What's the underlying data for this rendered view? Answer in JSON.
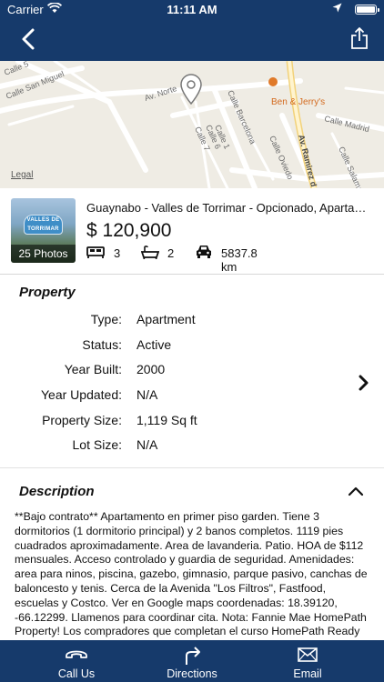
{
  "status_bar": {
    "carrier": "Carrier",
    "time": "11:11 AM"
  },
  "nav": {
    "back_icon": "chevron-left-icon",
    "share_icon": "share-icon"
  },
  "map": {
    "legal": "Legal",
    "street_labels": [
      "Calle 5",
      "Calle San Miguel",
      "Av. Norte",
      "Calle Barcelona",
      "Calle 6",
      "Calle 7",
      "Calle 1",
      "Calle Madrid",
      "Calle Oviedo",
      "Av. Ramirez d",
      "Calle Salaman"
    ],
    "poi": "Ben & Jerry's",
    "pin_icon": "map-pin-icon"
  },
  "listing": {
    "photo_count": "25 Photos",
    "photo_sign": "VALLES DE TORRIMAR",
    "title": "Guaynabo - Valles de Torrimar - Opcionado, Apartamento",
    "price": "$ 120,900",
    "beds": "3",
    "baths": "2",
    "distance": "5837.8 km"
  },
  "property": {
    "title": "Property",
    "rows": [
      {
        "label": "Type:",
        "value": "Apartment"
      },
      {
        "label": "Status:",
        "value": "Active"
      },
      {
        "label": "Year Built:",
        "value": "2000"
      },
      {
        "label": "Year Updated:",
        "value": "N/A"
      },
      {
        "label": "Property Size:",
        "value": "1,119 Sq ft"
      },
      {
        "label": "Lot Size:",
        "value": "N/A"
      }
    ]
  },
  "description": {
    "title": "Description",
    "text": "**Bajo contrato** Apartamento en primer piso garden. Tiene 3 dormitorios (1 dormitorio principal) y 2 banos completos. 1119 pies cuadrados aproximadamente. Area de lavanderia. Patio. HOA de $112 mensuales. Acceso controlado y guardia de seguridad. Amenidades: area para ninos, piscina, gazebo, gimnasio, parque pasivo, canchas de baloncesto y tenis. Cerca de la Avenida \"Los Filtros\", Fastfood, escuelas y Costco. Ver en Google maps coordenadas: 18.39120, -66.12299. Llamenos para coordinar cita. Nota: Fannie Mae HomePath Property! Los compradores que completan el curso HomePath Ready Homeownership pueden adjuntar el certificado con la oferta y solicitar"
  },
  "tabbar": {
    "call": "Call Us",
    "directions": "Directions",
    "email": "Email"
  },
  "colors": {
    "brand": "#163a6b",
    "map_bg": "#efece4",
    "poi": "#e07a2a"
  }
}
